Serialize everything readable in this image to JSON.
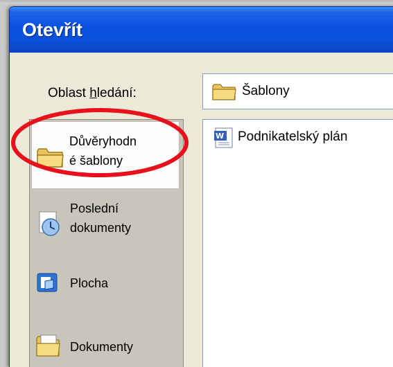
{
  "window": {
    "title": "Otevřít"
  },
  "look_in": {
    "label_prefix": "Oblast ",
    "label_accel": "h",
    "label_suffix": "ledání:",
    "value": "Šablony",
    "icon": "folder-icon"
  },
  "places": [
    {
      "line1": "Důvěryhodn",
      "line2": "é šablony",
      "icon": "folder-icon",
      "highlighted": true
    },
    {
      "line1": "Poslední",
      "line2": "dokumenty",
      "icon": "recent-documents-icon"
    },
    {
      "line1": "Plocha",
      "icon": "desktop-icon"
    },
    {
      "line1": "Dokumenty",
      "icon": "my-documents-icon"
    }
  ],
  "files": [
    {
      "name": "Podnikatelský plán",
      "icon": "word-template-icon"
    }
  ],
  "colors": {
    "titlebar": "#0a54e3",
    "annotation_ring": "#e8101a"
  }
}
